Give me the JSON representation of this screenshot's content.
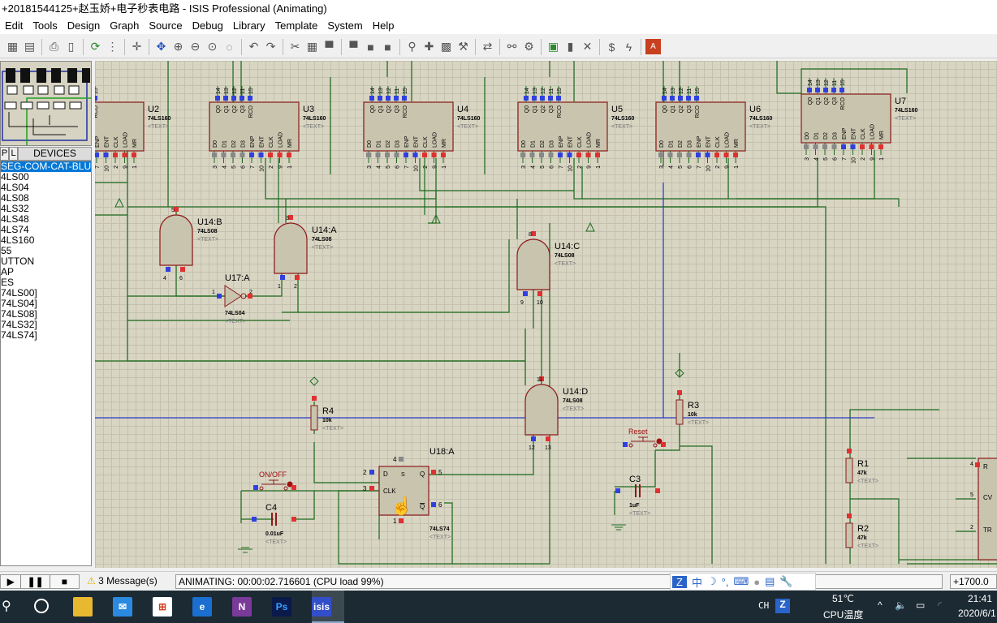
{
  "window": {
    "title": "+20181544125+赵玉娇+电子秒表电路 - ISIS Professional (Animating)"
  },
  "menu": [
    "Edit",
    "Tools",
    "Design",
    "Graph",
    "Source",
    "Debug",
    "Library",
    "Template",
    "System",
    "Help"
  ],
  "toolbar_icons": [
    "copy-icon",
    "paste-icon",
    "print-icon",
    "page-icon",
    "refresh-icon",
    "grid-icon",
    "origin-icon",
    "pan-icon",
    "zoom-in-icon",
    "zoom-out-icon",
    "zoom-all-icon",
    "zoom-area-icon",
    "undo-icon",
    "redo-icon",
    "cut-icon",
    "copy-icon",
    "block-copy-icon",
    "block-move-icon",
    "block-rotate-icon",
    "block-delete-icon",
    "pick-device-icon",
    "make-device-icon",
    "package-icon",
    "decompose-icon",
    "wire-autorouter-icon",
    "search-icon",
    "property-tool-icon",
    "new-sheet-icon",
    "remove-sheet-icon",
    "exit-parent-icon",
    "view-bom-icon",
    "electrical-check-icon",
    "ares-icon"
  ],
  "devices": {
    "tab_p": "P",
    "tab_l": "L",
    "header": "DEVICES",
    "items": [
      "SEG-COM-CAT-BLUE",
      "4LS00",
      "4LS04",
      "4LS08",
      "4LS32",
      "4LS48",
      "4LS74",
      "4LS160",
      "55",
      "UTTON",
      "AP",
      "ES",
      "74LS00]",
      "74LS04]",
      "74LS08]",
      "74LS32]",
      "74LS74]"
    ],
    "selected": 0
  },
  "schematic": {
    "counters": [
      {
        "ref": "U2",
        "part": "74LS160",
        "text": "<TEXT>"
      },
      {
        "ref": "U3",
        "part": "74LS160",
        "text": "<TEXT>"
      },
      {
        "ref": "U4",
        "part": "74LS160",
        "text": "<TEXT>"
      },
      {
        "ref": "U5",
        "part": "74LS160",
        "text": "<TEXT>"
      },
      {
        "ref": "U6",
        "part": "74LS160",
        "text": "<TEXT>"
      },
      {
        "ref": "U7",
        "part": "74LS160",
        "text": "<TEXT>"
      }
    ],
    "counter_top_pins": [
      "Q0",
      "Q1",
      "Q2",
      "Q3",
      "RCO"
    ],
    "counter_top_nums": [
      "14",
      "13",
      "12",
      "11",
      "15"
    ],
    "counter_bottom_pins": [
      "D0",
      "D1",
      "D2",
      "D3",
      "ENP",
      "ENT",
      "CLK",
      "LOAD",
      "MR"
    ],
    "counter_bottom_nums": [
      "3",
      "4",
      "5",
      "6",
      "7",
      "10",
      "2",
      "9",
      "1"
    ],
    "gates": [
      {
        "ref": "U14:B",
        "part": "74LS08",
        "text": "<TEXT>",
        "pins": [
          "5",
          "4",
          "6"
        ]
      },
      {
        "ref": "U14:A",
        "part": "74LS08",
        "text": "<TEXT>",
        "pins": [
          "3",
          "1",
          "2"
        ]
      },
      {
        "ref": "U14:C",
        "part": "74LS08",
        "text": "<TEXT>",
        "pins": [
          "8",
          "9",
          "10"
        ]
      },
      {
        "ref": "U14:D",
        "part": "74LS08",
        "text": "<TEXT>",
        "pins": [
          "11",
          "12",
          "13"
        ]
      }
    ],
    "inverter": {
      "ref": "U17:A",
      "part": "74LS04",
      "text": "<TEXT>",
      "pins": [
        "1",
        "2"
      ]
    },
    "flipflop": {
      "ref": "U18:A",
      "part": "74LS74",
      "text": "<TEXT>",
      "pins": {
        "D": "D",
        "CLK": "CLK",
        "Q": "Q",
        "QB": "Q",
        "S": "S",
        "R": "R"
      },
      "nums": [
        "2",
        "3",
        "5",
        "6",
        "4",
        "1"
      ]
    },
    "resistors": [
      {
        "ref": "R4",
        "value": "10k",
        "text": "<TEXT>"
      },
      {
        "ref": "R3",
        "value": "10k",
        "text": "<TEXT>"
      },
      {
        "ref": "R1",
        "value": "47k",
        "text": "<TEXT>"
      },
      {
        "ref": "R2",
        "value": "47k",
        "text": "<TEXT>"
      }
    ],
    "capacitors": [
      {
        "ref": "C4",
        "value": "0.01uF",
        "text": "<TEXT>"
      },
      {
        "ref": "C3",
        "value": "1uF",
        "text": "<TEXT>"
      }
    ],
    "buttons": [
      {
        "label": "ON/OFF"
      },
      {
        "label": "Reset"
      }
    ],
    "timer_pins": [
      "4",
      "5",
      "2"
    ],
    "timer_labels": [
      "R",
      "CV",
      "TR"
    ],
    "colors": {
      "wire": "#1f6b1f",
      "bus": "#2a3cc8",
      "body": "#c8c4ae",
      "outline": "#8b1a1a",
      "pin_high": "#e03030",
      "pin_low": "#3040e0"
    }
  },
  "status": {
    "messages": "3 Message(s)",
    "animating": "ANIMATING: 00:00:02.716601 (CPU load 99%)",
    "coord": "+1700.0"
  },
  "ime": {
    "mode": "中"
  },
  "taskbar": {
    "lang": "CH",
    "temp": "51℃",
    "temp_label": "CPU温度",
    "time": "21:41",
    "date": "2020/6/1",
    "apps": [
      "file-explorer-icon",
      "mail-icon",
      "store-icon",
      "edge-icon",
      "onenote-icon",
      "photoshop-icon",
      "isis-icon"
    ]
  }
}
